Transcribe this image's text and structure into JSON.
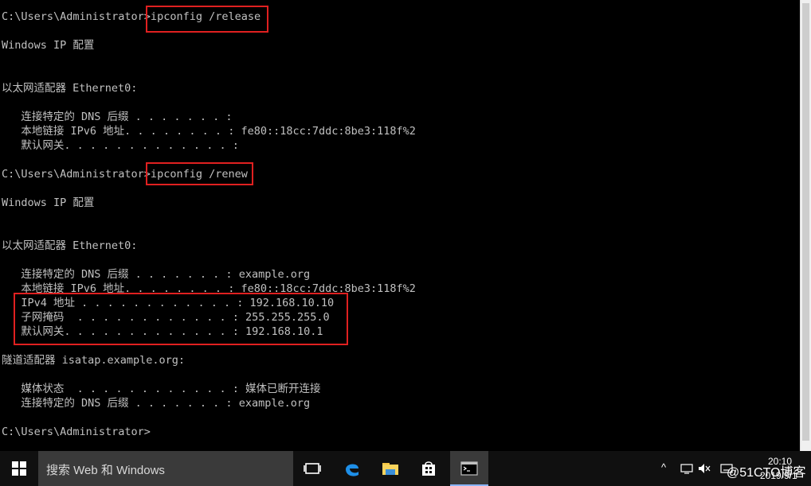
{
  "console": {
    "lines": [
      "C:\\Users\\Administrator>ipconfig /release",
      "",
      "Windows IP 配置",
      "",
      "",
      "以太网适配器 Ethernet0:",
      "",
      "   连接特定的 DNS 后缀 . . . . . . . :",
      "   本地链接 IPv6 地址. . . . . . . . : fe80::18cc:7ddc:8be3:118f%2",
      "   默认网关. . . . . . . . . . . . . :",
      "",
      "C:\\Users\\Administrator>ipconfig /renew",
      "",
      "Windows IP 配置",
      "",
      "",
      "以太网适配器 Ethernet0:",
      "",
      "   连接特定的 DNS 后缀 . . . . . . . : example.org",
      "   本地链接 IPv6 地址. . . . . . . . : fe80::18cc:7ddc:8be3:118f%2",
      "   IPv4 地址 . . . . . . . . . . . . : 192.168.10.10",
      "   子网掩码  . . . . . . . . . . . . : 255.255.255.0",
      "   默认网关. . . . . . . . . . . . . : 192.168.10.1",
      "",
      "隧道适配器 isatap.example.org:",
      "",
      "   媒体状态  . . . . . . . . . . . . : 媒体已断开连接",
      "   连接特定的 DNS 后缀 . . . . . . . : example.org",
      "",
      "C:\\Users\\Administrator>"
    ]
  },
  "colors": {
    "console_bg": "#000000",
    "console_text": "#c0c0c0",
    "highlight": "#e02020",
    "taskbar_bg": "#101010"
  },
  "taskbar": {
    "search_placeholder": "搜索 Web 和 Windows",
    "icons": [
      "windows-start-icon",
      "task-view-icon",
      "edge-browser-icon",
      "file-explorer-icon",
      "store-icon",
      "cmd-icon"
    ],
    "tray": {
      "up_arrow": "^",
      "time": "20:10",
      "date": "2019/9/1",
      "watermark": "@51CTO博客"
    }
  }
}
